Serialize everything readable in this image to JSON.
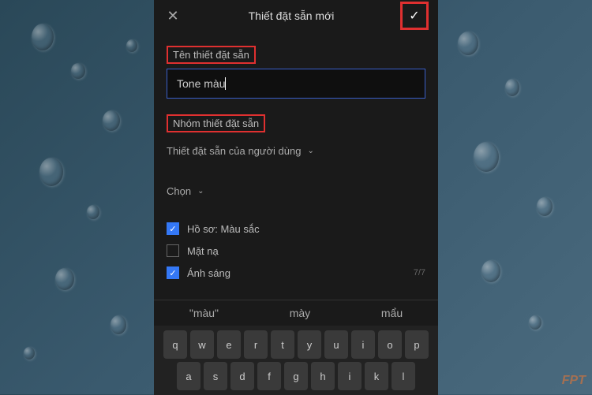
{
  "header": {
    "title": "Thiết đặt sẵn mới"
  },
  "form": {
    "name_label": "Tên thiết đặt sẵn",
    "name_value": "Tone màu",
    "group_label": "Nhóm thiết đặt sẵn",
    "group_value": "Thiết đặt sẵn của người dùng",
    "select_label": "Chọn"
  },
  "options": [
    {
      "label": "Hồ sơ: Màu sắc",
      "checked": true,
      "count": ""
    },
    {
      "label": "Mặt nạ",
      "checked": false,
      "count": ""
    },
    {
      "label": "Ánh sáng",
      "checked": true,
      "count": "7/7"
    }
  ],
  "suggestions": [
    "\"màu\"",
    "mày",
    "mẩu"
  ],
  "keys_row1": [
    "q",
    "w",
    "e",
    "r",
    "t",
    "y",
    "u",
    "i",
    "o",
    "p"
  ],
  "keys_row2": [
    "a",
    "s",
    "d",
    "f",
    "g",
    "h",
    "i",
    "k",
    "l"
  ],
  "watermark": "FPT"
}
